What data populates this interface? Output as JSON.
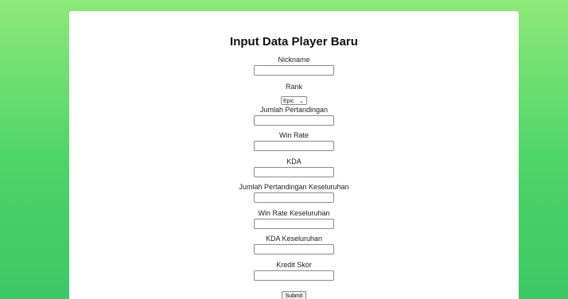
{
  "form": {
    "title": "Input Data Player Baru",
    "fields": [
      {
        "label": "Nickname",
        "value": ""
      },
      {
        "label": "Rank",
        "value": "Epic"
      },
      {
        "label": "Jumlah Pertandingan",
        "value": ""
      },
      {
        "label": "Win Rate",
        "value": ""
      },
      {
        "label": "KDA",
        "value": ""
      },
      {
        "label": "Jumlah Pertandingan Keseluruhan",
        "value": ""
      },
      {
        "label": "Win Rate Keseluruhan",
        "value": ""
      },
      {
        "label": "KDA Keseluruhan",
        "value": ""
      },
      {
        "label": "Kredit Skor",
        "value": ""
      }
    ],
    "submit_label": "Submit"
  },
  "icons": {
    "rank_dropdown": "chevron-down-icon"
  }
}
